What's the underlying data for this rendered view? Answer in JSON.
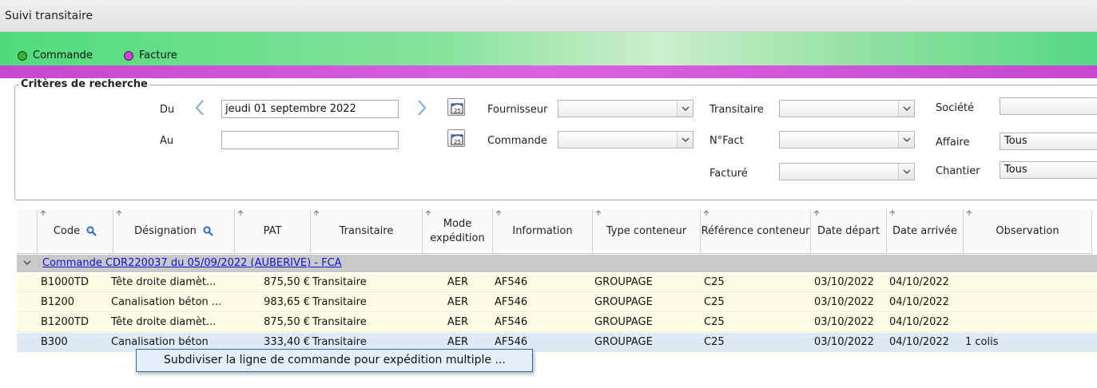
{
  "window": {
    "title": "Suivi transitaire"
  },
  "legend": [
    {
      "label": "Commande",
      "color": "#2fb52f"
    },
    {
      "label": "Facture",
      "color": "#d23ee0"
    }
  ],
  "criteria": {
    "title": "Critères de recherche",
    "du_label": "Du",
    "du_value": "jeudi 01 septembre 2022",
    "au_label": "Au",
    "au_value": "",
    "fournisseur_label": "Fournisseur",
    "commande_label": "Commande",
    "transitaire_label": "Transitaire",
    "nfact_label": "N°Fact",
    "facture_label": "Facturé",
    "societe_label": "Société",
    "affaire_label": "Affaire",
    "affaire_value": "Tous",
    "chantier_label": "Chantier",
    "chantier_value": "Tous",
    "calendar_glyph": "25"
  },
  "grid": {
    "columns": [
      {
        "label": "Code",
        "search": true
      },
      {
        "label": "Désignation",
        "search": true
      },
      {
        "label": "PAT"
      },
      {
        "label": "Transitaire"
      },
      {
        "label": "Mode expédition"
      },
      {
        "label": "Information"
      },
      {
        "label": "Type conteneur"
      },
      {
        "label": "Référence conteneur"
      },
      {
        "label": "Date départ"
      },
      {
        "label": "Date arrivée"
      },
      {
        "label": "Observation"
      }
    ],
    "group_label": "Commande CDR220037 du 05/09/2022 (AUBERIVE) - FCA",
    "rows": [
      {
        "code": "B1000TD",
        "designation": "Tête droite diamèt...",
        "pat": "875,50 €",
        "transitaire": "Transitaire",
        "mode": "AER",
        "information": "AF546",
        "type": "GROUPAGE",
        "reference": "C25",
        "depart": "03/10/2022",
        "arrivee": "04/10/2022",
        "observation": ""
      },
      {
        "code": "B1200",
        "designation": "Canalisation béton ...",
        "pat": "983,65 €",
        "transitaire": "Transitaire",
        "mode": "AER",
        "information": "AF546",
        "type": "GROUPAGE",
        "reference": "C25",
        "depart": "03/10/2022",
        "arrivee": "04/10/2022",
        "observation": ""
      },
      {
        "code": "B1200TD",
        "designation": "Tête droite diamèt...",
        "pat": "875,50 €",
        "transitaire": "Transitaire",
        "mode": "AER",
        "information": "AF546",
        "type": "GROUPAGE",
        "reference": "C25",
        "depart": "03/10/2022",
        "arrivee": "04/10/2022",
        "observation": ""
      },
      {
        "code": "B300",
        "designation": "Canalisation béton",
        "pat": "333,40 €",
        "transitaire": "Transitaire",
        "mode": "AER",
        "information": "AF546",
        "type": "GROUPAGE",
        "reference": "C25",
        "depart": "03/10/2022",
        "arrivee": "04/10/2022",
        "observation": "1 colis"
      }
    ]
  },
  "context_menu": {
    "item": "Subdiviser la ligne de commande pour expédition multiple ..."
  }
}
